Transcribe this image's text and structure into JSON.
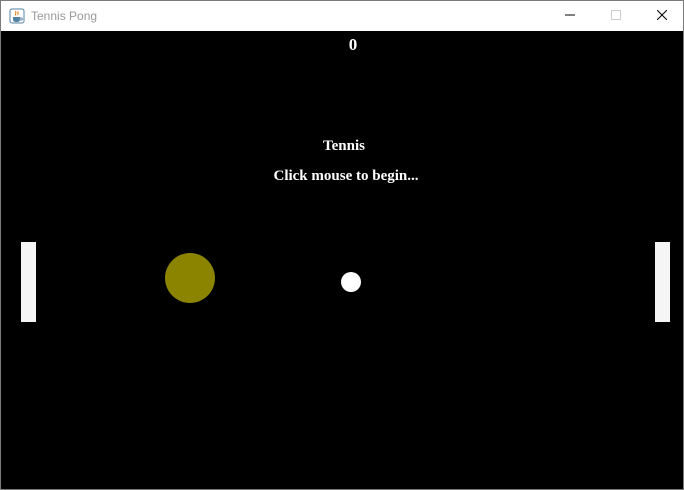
{
  "window": {
    "title": "Tennis Pong",
    "icon": "java-cup-icon",
    "controls": [
      "minimize-icon",
      "maximize-icon",
      "close-icon"
    ]
  },
  "game": {
    "score": "0",
    "title": "Tennis",
    "prompt": "Click mouse to begin...",
    "colors": {
      "background": "#000000",
      "paddle": "#f5f5f5",
      "tennis_ball": "#8a8400",
      "ball": "#ffffff"
    }
  }
}
